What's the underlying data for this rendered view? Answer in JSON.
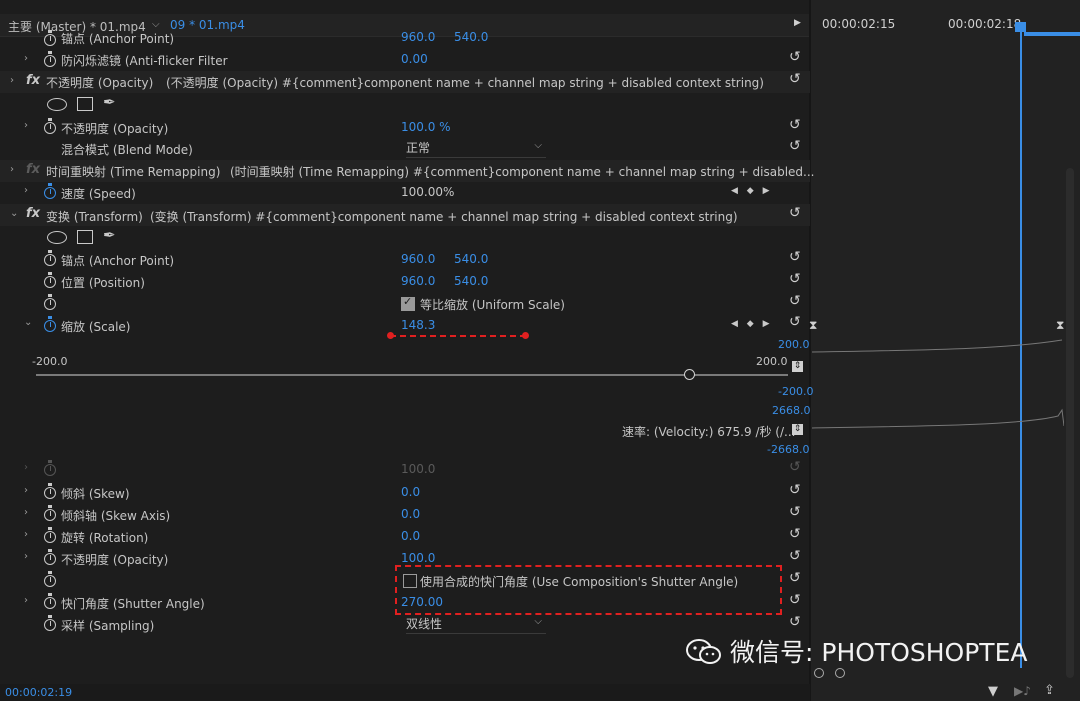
{
  "tabs": {
    "master": "主要 (Master) * 01.mp4",
    "clip": "09 * 01.mp4"
  },
  "timeline": {
    "timecode1": "00:00:02:15",
    "timecode2": "00:00:02:18"
  },
  "rows": {
    "anchor_top": {
      "label": "锚点 (Anchor Point)",
      "x": "960.0",
      "y": "540.0"
    },
    "antiflicker": {
      "label": "防闪烁滤镜 (Anti-flicker Filter",
      "value": "0.00"
    },
    "opacity_fx": {
      "label": "不透明度 (Opacity)",
      "desc": "(不透明度 (Opacity) #{comment}component name + channel map string + disabled context string)"
    },
    "opacity": {
      "label": "不透明度 (Opacity)",
      "value": "100.0 %"
    },
    "blend": {
      "label": "混合模式 (Blend Mode)",
      "value": "正常"
    },
    "timeremap_fx": {
      "label": "时间重映射 (Time Remapping)",
      "desc": "(时间重映射 (Time Remapping) #{comment}component name + channel map string + disabled..."
    },
    "speed": {
      "label": "速度 (Speed)",
      "value": "100.00%"
    },
    "transform_fx": {
      "label": "变换 (Transform)",
      "desc": "(变换 (Transform) #{comment}component name + channel map string + disabled context string)"
    },
    "anchor": {
      "label": "锚点 (Anchor Point)",
      "x": "960.0",
      "y": "540.0"
    },
    "position": {
      "label": "位置 (Position)",
      "x": "960.0",
      "y": "540.0"
    },
    "uniform_scale": {
      "label": "等比缩放 (Uniform Scale)"
    },
    "scale": {
      "label": "缩放 (Scale)",
      "value": "148.3"
    },
    "scale_graph": {
      "slider_min": "-200.0",
      "slider_max": "200.0",
      "value_max": "200.0",
      "value_min": "-200.0",
      "velocity_max": "2668.0",
      "velocity_min": "-2668.0",
      "velocity_label": "速率: (Velocity:) 675.9 /秒 (/..."
    },
    "hidden_scale": {
      "value": "100.0"
    },
    "skew": {
      "label": "倾斜 (Skew)",
      "value": "0.0"
    },
    "skew_axis": {
      "label": "倾斜轴 (Skew Axis)",
      "value": "0.0"
    },
    "rotation": {
      "label": "旋转 (Rotation)",
      "value": "0.0"
    },
    "opacity2": {
      "label": "不透明度 (Opacity)",
      "value": "100.0"
    },
    "comp_shutter": {
      "label": "使用合成的快门角度 (Use Composition's Shutter Angle)"
    },
    "shutter": {
      "label": "快门角度 (Shutter Angle)",
      "value": "270.00"
    },
    "sampling": {
      "label": "采样 (Sampling)",
      "value": "双线性"
    }
  },
  "watermark": "微信号: PHOTOSHOPTEA",
  "status": {
    "timecode": "00:00:02:19"
  },
  "colors": {
    "accent": "#3a8ee6",
    "highlight": "#e02020"
  }
}
